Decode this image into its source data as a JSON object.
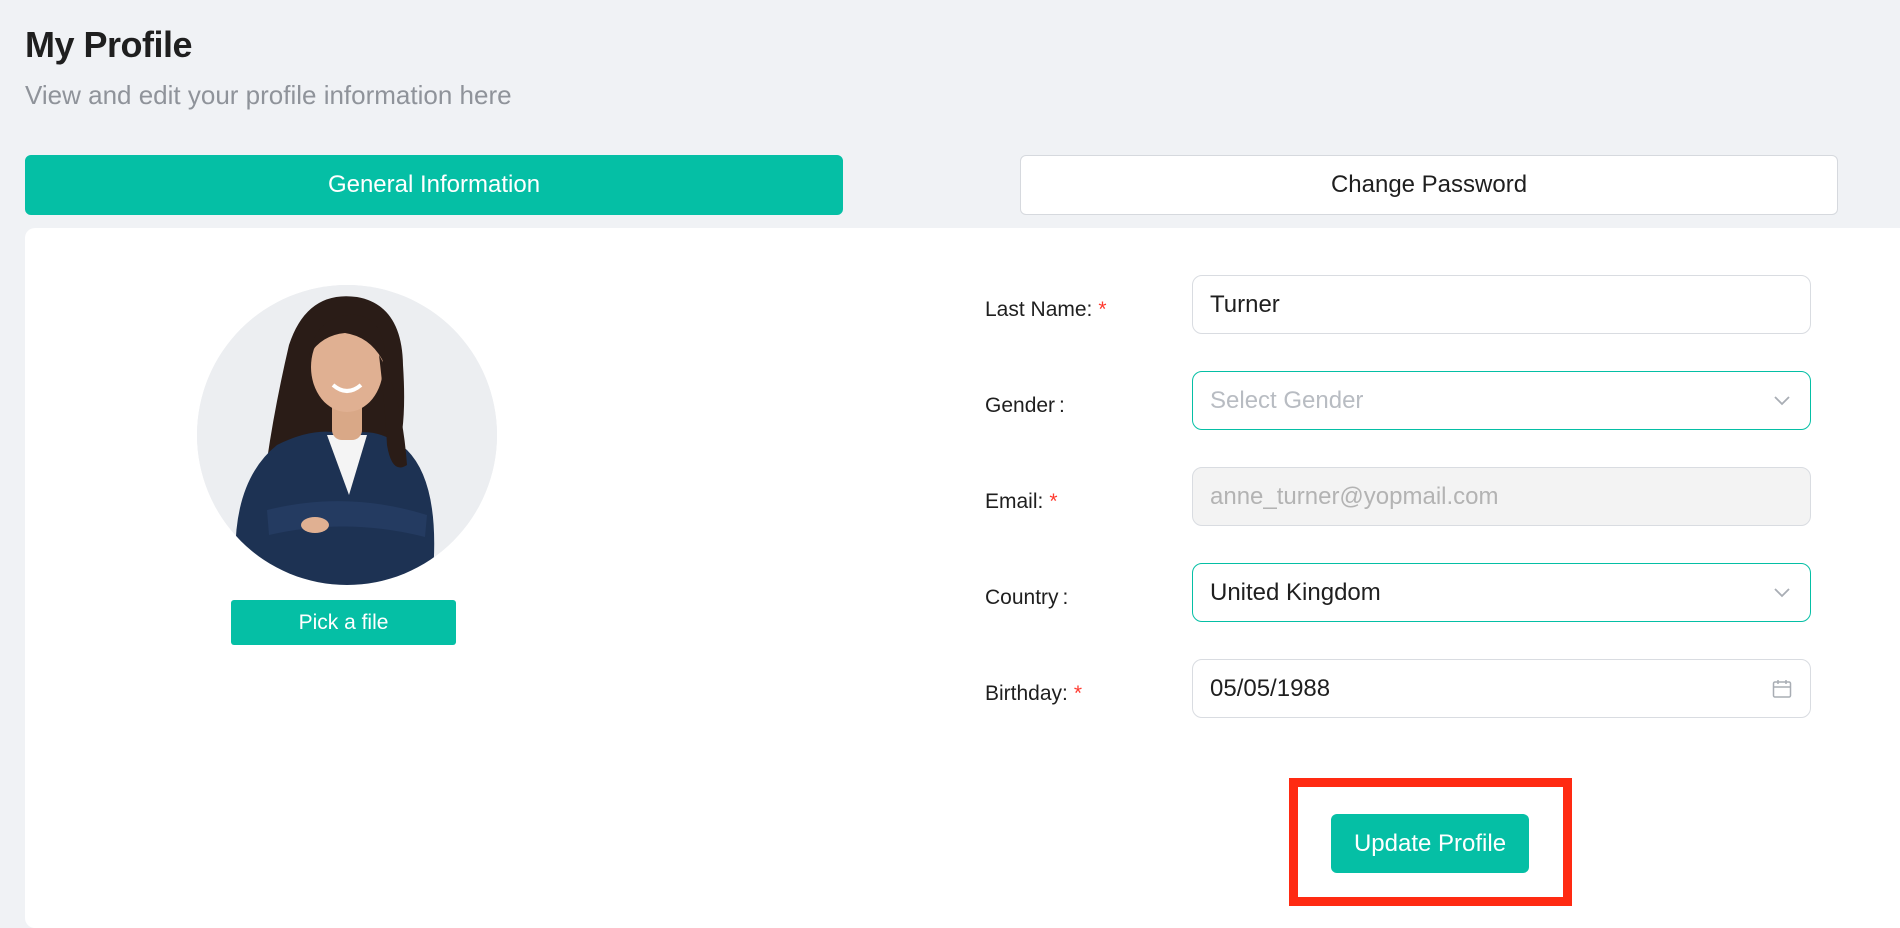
{
  "header": {
    "title": "My Profile",
    "subtitle": "View and edit your profile information here"
  },
  "tabs": [
    {
      "label": "General Information",
      "active": true
    },
    {
      "label": "Change Password",
      "active": false
    }
  ],
  "avatar": {
    "alt": "profile-photo",
    "pick_label": "Pick a file"
  },
  "form": {
    "last_name": {
      "label": "Last Name:",
      "required": "*",
      "value": "Turner"
    },
    "gender": {
      "label": "Gender",
      "colon": ":",
      "value": "",
      "placeholder": "Select Gender"
    },
    "email": {
      "label": "Email:",
      "required": "*",
      "value": "anne_turner@yopmail.com"
    },
    "country": {
      "label": "Country",
      "colon": ":",
      "value": "United Kingdom"
    },
    "birthday": {
      "label": "Birthday:",
      "required": "*",
      "value": "05/05/1988"
    }
  },
  "actions": {
    "update_label": "Update Profile"
  },
  "colors": {
    "accent": "#05bfa5",
    "highlight": "#ff2a12",
    "background": "#f0f2f5",
    "required": "#ff3b30"
  },
  "icons": {
    "gender_select": "chevron-down-icon",
    "country_select": "chevron-down-icon",
    "birthday": "calendar-icon"
  }
}
